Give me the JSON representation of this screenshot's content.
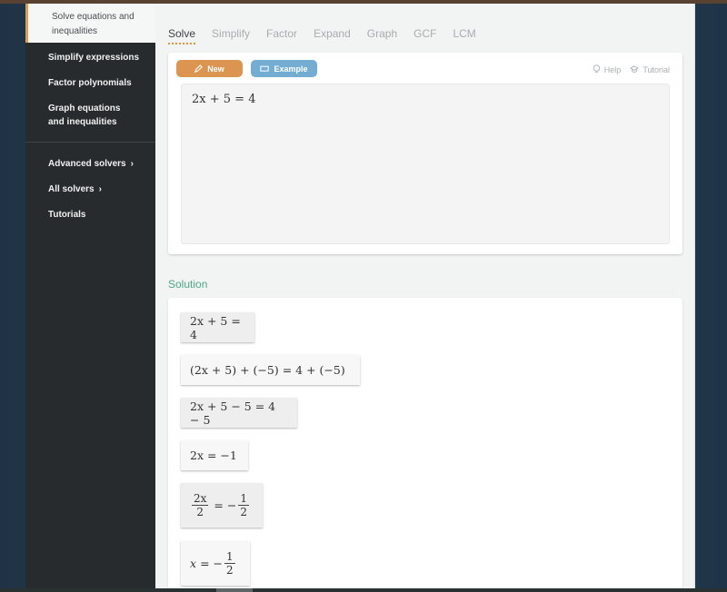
{
  "sidebar": {
    "active_item": "Solve equations and inequalities",
    "items": [
      {
        "label": "Simplify expressions"
      },
      {
        "label": "Factor polynomials"
      },
      {
        "label": "Graph equations and inequalities"
      }
    ],
    "secondary_items": [
      {
        "label": "Advanced solvers",
        "chevron": "›"
      },
      {
        "label": "All solvers",
        "chevron": "›"
      },
      {
        "label": "Tutorials"
      }
    ]
  },
  "tabs": [
    {
      "label": "Solve",
      "active": true
    },
    {
      "label": "Simplify"
    },
    {
      "label": "Factor"
    },
    {
      "label": "Expand"
    },
    {
      "label": "Graph"
    },
    {
      "label": "GCF"
    },
    {
      "label": "LCM"
    }
  ],
  "toolbar": {
    "new_label": "New",
    "new_icon": "pencil-icon",
    "example_label": "Example",
    "example_icon": "book-icon",
    "help_label": "Help",
    "help_icon": "lightbulb-icon",
    "tutorial_label": "Tutorial",
    "tutorial_icon": "graduation-cap-icon"
  },
  "editor": {
    "value": "2x + 5 = 4"
  },
  "solution": {
    "title": "Solution",
    "steps": [
      {
        "text": "2x + 5 = 4"
      },
      {
        "text": "(2x + 5) + (−5) = 4 + (−5)"
      },
      {
        "text": "2x + 5 − 5 = 4 − 5"
      },
      {
        "text": "2x = −1"
      },
      {
        "text": "2x/2 = −1/2",
        "lhs_num": "2x",
        "lhs_den": "2",
        "rhs_sign": "−",
        "rhs_num": "1",
        "rhs_den": "2"
      },
      {
        "text": "x = −1/2",
        "lhs": "x",
        "rhs_sign": "−",
        "rhs_num": "1",
        "rhs_den": "2"
      }
    ]
  },
  "colors": {
    "accent_orange": "#db9550",
    "accent_blue": "#73aed2",
    "solution_green": "#4ea884",
    "sidebar_bg": "#272b2d",
    "active_indicator": "#d9a057"
  }
}
